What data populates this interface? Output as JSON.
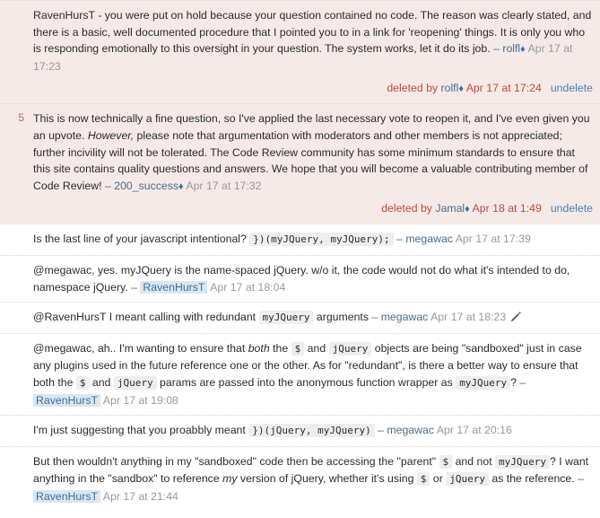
{
  "meta": {
    "accent_link": "#4a6b8a",
    "deleted_bg": "#f5eae8",
    "deleted_text": "#c24a3c",
    "code_bg": "#eeeeee",
    "owner_highlight": "#d7e8f5",
    "score_color": "#b5704a",
    "date_color": "#999999"
  },
  "labels": {
    "dash": "–",
    "mod_diamond": "♦",
    "undelete": "undelete",
    "deleted_by_prefix": "deleted by",
    "edit_icon": "pencil-icon"
  },
  "comments": [
    {
      "id": "c1",
      "deleted": true,
      "score": "",
      "parts": [
        {
          "type": "text",
          "value": "RavenHursT - you were put on hold because your question contained no code. The reason was clearly stated, and there is a basic, well documented procedure that I pointed you to in a link for 'reopening' things. It is only you who is responding emotionally to this oversight in your question. The system works, let it do its job. "
        },
        {
          "type": "dash",
          "value": "–"
        },
        {
          "type": "user",
          "value": "rolfl",
          "owner": false
        },
        {
          "type": "diamond",
          "value": "♦"
        },
        {
          "type": "date",
          "value": "Apr 17 at 17:23"
        }
      ],
      "deletion": {
        "prefix": "deleted by",
        "user": "rolfl",
        "diamond": "♦",
        "date": "Apr 17 at 17:24",
        "undelete": "undelete"
      }
    },
    {
      "id": "c2",
      "deleted": true,
      "score": "5",
      "parts": [
        {
          "type": "text",
          "value": "This is now technically a fine question, so I've applied the last necessary vote to reopen it, and I've even given you an upvote. "
        },
        {
          "type": "italic",
          "value": "However,"
        },
        {
          "type": "text",
          "value": " please note that argumentation with moderators and other members is not appreciated; further incivility will not be tolerated. The Code Review community has some minimum standards to ensure that this site contains quality questions and answers. We hope that you will become a valuable contributing member of Code Review! "
        },
        {
          "type": "dash",
          "value": "–"
        },
        {
          "type": "user",
          "value": "200_success",
          "owner": false
        },
        {
          "type": "diamond",
          "value": "♦"
        },
        {
          "type": "date",
          "value": "Apr 17 at 17:32"
        }
      ],
      "deletion": {
        "prefix": "deleted by",
        "user": "Jamal",
        "diamond": "♦",
        "date": "Apr 18 at 1:49",
        "undelete": "undelete"
      }
    },
    {
      "id": "c3",
      "deleted": false,
      "score": "",
      "parts": [
        {
          "type": "text",
          "value": "Is the last line of your javascript intentional? "
        },
        {
          "type": "code",
          "value": "})(myJQuery, myJQuery);"
        },
        {
          "type": "text",
          "value": " "
        },
        {
          "type": "dash",
          "value": "–"
        },
        {
          "type": "user",
          "value": "megawac",
          "owner": false
        },
        {
          "type": "date",
          "value": "Apr 17 at 17:39"
        }
      ],
      "deletion": null
    },
    {
      "id": "c4",
      "deleted": false,
      "score": "",
      "parts": [
        {
          "type": "text",
          "value": "@megawac, yes. myJQuery is the name-spaced jQuery. w/o it, the code would not do what it's intended to do, namespace jQuery. "
        },
        {
          "type": "dash",
          "value": "–"
        },
        {
          "type": "user",
          "value": "RavenHursT",
          "owner": true
        },
        {
          "type": "date",
          "value": "Apr 17 at 18:04"
        }
      ],
      "deletion": null
    },
    {
      "id": "c5",
      "deleted": false,
      "score": "",
      "parts": [
        {
          "type": "text",
          "value": "@RavenHursT I meant calling with redundant "
        },
        {
          "type": "code",
          "value": "myJQuery"
        },
        {
          "type": "text",
          "value": " arguments "
        },
        {
          "type": "dash",
          "value": "–"
        },
        {
          "type": "user",
          "value": "megawac",
          "owner": false
        },
        {
          "type": "date",
          "value": "Apr 17 at 18:23"
        },
        {
          "type": "edit-icon",
          "value": "pencil-icon"
        }
      ],
      "deletion": null
    },
    {
      "id": "c6",
      "deleted": false,
      "score": "",
      "parts": [
        {
          "type": "text",
          "value": "@megawac, ah.. I'm wanting to ensure that "
        },
        {
          "type": "italic",
          "value": "both"
        },
        {
          "type": "text",
          "value": " the "
        },
        {
          "type": "code",
          "value": "$"
        },
        {
          "type": "text",
          "value": " and "
        },
        {
          "type": "code",
          "value": "jQuery"
        },
        {
          "type": "text",
          "value": " objects are being \"sandboxed\" just in case any plugins used in the future reference one or the other. As for \"redundant\", is there a better way to ensure that both the "
        },
        {
          "type": "code",
          "value": "$"
        },
        {
          "type": "text",
          "value": " and "
        },
        {
          "type": "code",
          "value": "jQuery"
        },
        {
          "type": "text",
          "value": " params are passed into the anonymous function wrapper as "
        },
        {
          "type": "code",
          "value": "myJQuery"
        },
        {
          "type": "text",
          "value": "? "
        },
        {
          "type": "dash",
          "value": "–"
        },
        {
          "type": "user",
          "value": "RavenHursT",
          "owner": true
        },
        {
          "type": "date",
          "value": "Apr 17 at 19:08"
        }
      ],
      "deletion": null
    },
    {
      "id": "c7",
      "deleted": false,
      "score": "",
      "parts": [
        {
          "type": "text",
          "value": "I'm just suggesting that you proabbly meant "
        },
        {
          "type": "code",
          "value": "})(jQuery, myJQuery)"
        },
        {
          "type": "text",
          "value": " "
        },
        {
          "type": "dash",
          "value": "–"
        },
        {
          "type": "user",
          "value": "megawac",
          "owner": false
        },
        {
          "type": "date",
          "value": "Apr 17 at 20:16"
        }
      ],
      "deletion": null
    },
    {
      "id": "c8",
      "deleted": false,
      "score": "",
      "parts": [
        {
          "type": "text",
          "value": "But then wouldn't anything in my \"sandboxed\" code then be accessing the \"parent\" "
        },
        {
          "type": "code",
          "value": "$"
        },
        {
          "type": "text",
          "value": " and not "
        },
        {
          "type": "code",
          "value": "myJQuery"
        },
        {
          "type": "text",
          "value": "? I want anything in the \"sandbox\" to reference "
        },
        {
          "type": "italic",
          "value": "my"
        },
        {
          "type": "text",
          "value": " version of jQuery, whether it's using "
        },
        {
          "type": "code",
          "value": "$"
        },
        {
          "type": "text",
          "value": " or "
        },
        {
          "type": "code",
          "value": "jQuery"
        },
        {
          "type": "text",
          "value": " as the reference. "
        },
        {
          "type": "dash",
          "value": "–"
        },
        {
          "type": "user",
          "value": "RavenHursT",
          "owner": true
        },
        {
          "type": "date",
          "value": "Apr 17 at 21:44"
        }
      ],
      "deletion": null
    }
  ]
}
